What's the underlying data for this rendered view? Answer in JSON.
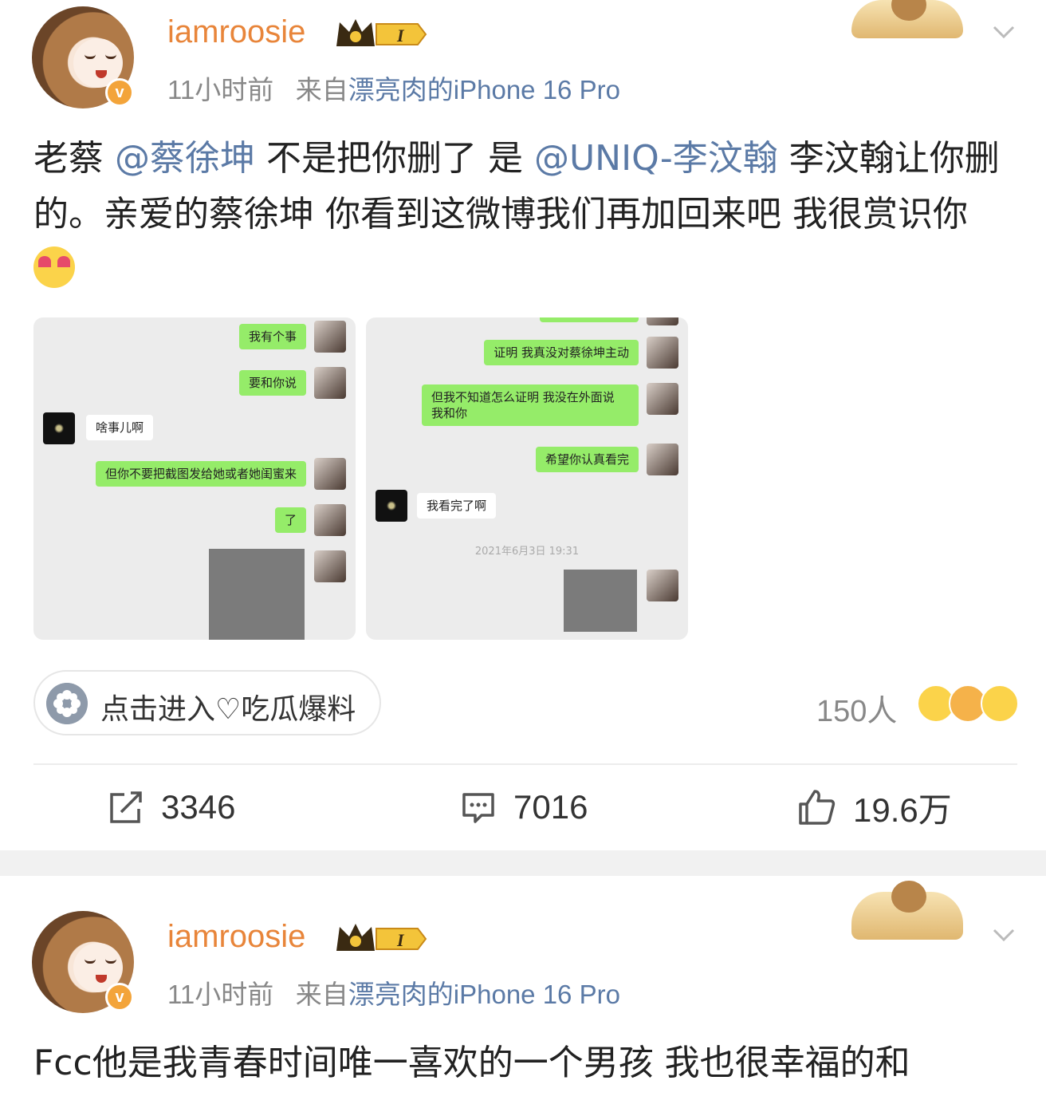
{
  "posts": [
    {
      "username": "iamroosie",
      "level_badge": "I",
      "time": "11小时前",
      "source_prefix": "来自",
      "source_device": "漂亮肉的iPhone 16 Pro",
      "text_segments": [
        {
          "text": "老蔡 ",
          "type": "plain"
        },
        {
          "text": "@蔡徐坤",
          "type": "mention"
        },
        {
          "text": " 不是把你删了 是 ",
          "type": "plain"
        },
        {
          "text": "@UNIQ-李汶翰",
          "type": "mention"
        },
        {
          "text": " 李汶翰让你删的。亲爱的蔡徐坤 你看到这微博我们再加回来吧 我很赏识你",
          "type": "plain"
        }
      ],
      "emoji_icon": "heart-eyes-emoji-icon",
      "screenshots": {
        "left": {
          "messages": [
            {
              "side": "right",
              "text": "我有个事"
            },
            {
              "side": "right",
              "text": "要和你说"
            },
            {
              "side": "left",
              "text": "啥事儿啊"
            },
            {
              "side": "right",
              "text": "但你不要把截图发给她或者她闺蜜来"
            },
            {
              "side": "right",
              "text": "了"
            }
          ]
        },
        "right": {
          "messages": [
            {
              "side": "right",
              "text": "证明 我真没对蔡徐坤主动"
            },
            {
              "side": "right",
              "text": "但我不知道怎么证明 我没在外面说\n我和你"
            },
            {
              "side": "right",
              "text": "希望你认真看完"
            },
            {
              "side": "left",
              "text": "我看完了啊"
            }
          ],
          "timestamp": "2021年6月3日 19:31"
        }
      },
      "topic_label": "点击进入♡吃瓜爆料",
      "reaction_count": "150人",
      "actions": {
        "repost": "3346",
        "comment": "7016",
        "like": "19.6万"
      }
    },
    {
      "username": "iamroosie",
      "level_badge": "I",
      "time": "11小时前",
      "source_prefix": "来自",
      "source_device": "漂亮肉的iPhone 16 Pro",
      "text": "Fcc他是我青春时间唯一喜欢的一个男孩 我也很幸福的和"
    }
  ],
  "colors": {
    "username": "#e8853a",
    "mention": "#5b7aa6",
    "meta": "#888888",
    "chat_green": "#95ec69"
  }
}
